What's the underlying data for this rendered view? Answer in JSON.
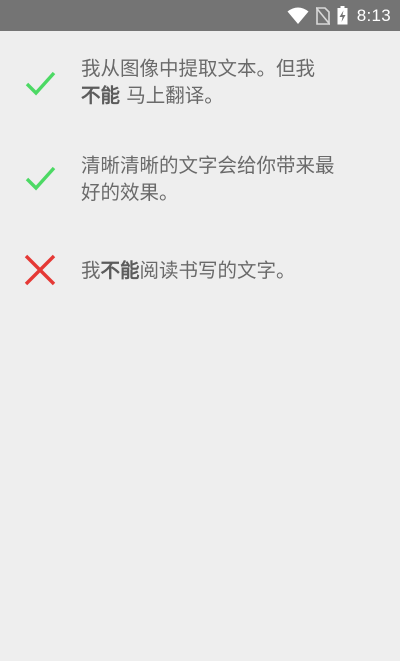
{
  "status_bar": {
    "time": "8:13",
    "icons": [
      "wifi-icon",
      "no-sim-icon",
      "battery-charging-icon"
    ]
  },
  "tips": [
    {
      "icon": "check-icon",
      "status_color": "#4cd964",
      "line1": "我从图像中提取文本。但我",
      "line2_bold": "不能",
      "line2_rest": " 马上翻译。"
    },
    {
      "icon": "check-icon",
      "status_color": "#4cd964",
      "line1": "清晰清晰的文字会给你带来最",
      "line2": "好的效果。"
    },
    {
      "icon": "cross-icon",
      "status_color": "#e53935",
      "pre": "我",
      "bold": "不能",
      "post": "阅读书写的文字。"
    }
  ]
}
